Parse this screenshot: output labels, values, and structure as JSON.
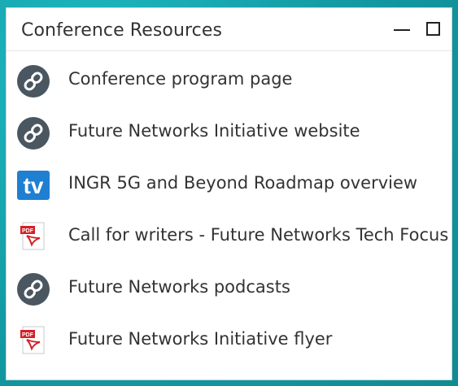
{
  "window": {
    "title": "Conference Resources",
    "controls": {
      "minimize": "minimize-icon",
      "maximize": "maximize-icon"
    }
  },
  "resources": [
    {
      "label": "Conference program page",
      "icon": "link-icon"
    },
    {
      "label": "Future Networks Initiative website",
      "icon": "link-icon"
    },
    {
      "label": "INGR 5G and Beyond Roadmap overview",
      "icon": "tv-icon"
    },
    {
      "label": "Call for writers - Future Networks Tech Focus",
      "icon": "pdf-icon"
    },
    {
      "label": "Future Networks podcasts",
      "icon": "link-icon"
    },
    {
      "label": "Future Networks Initiative flyer",
      "icon": "pdf-icon"
    }
  ],
  "colors": {
    "background": "#16a5ad",
    "panel": "#ffffff",
    "text": "#333333",
    "link_icon_bg": "#4a5660",
    "tv_icon_bg": "#1f7fd1",
    "pdf_red": "#d51f26"
  }
}
